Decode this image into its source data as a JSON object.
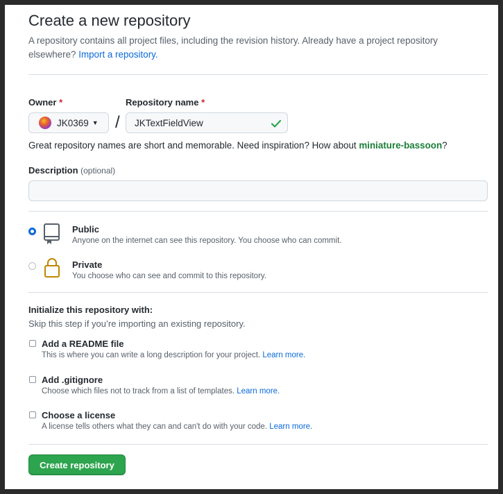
{
  "page": {
    "title": "Create a new repository",
    "intro_text": "A repository contains all project files, including the revision history. Already have a project repository elsewhere?",
    "import_link": "Import a repository."
  },
  "owner": {
    "label": "Owner",
    "required_mark": "*",
    "value": "JK0369"
  },
  "repo_name": {
    "label": "Repository name",
    "required_mark": "*",
    "value": "JKTextFieldView",
    "valid": true
  },
  "separator": "/",
  "suggestion": {
    "text": "Great repository names are short and memorable. Need inspiration? How about",
    "name": "miniature-bassoon",
    "suffix": "?"
  },
  "description": {
    "label": "Description",
    "optional": "(optional)",
    "value": ""
  },
  "visibility": {
    "selected": "public",
    "options": [
      {
        "id": "public",
        "title": "Public",
        "desc": "Anyone on the internet can see this repository. You choose who can commit.",
        "icon": "repo-icon"
      },
      {
        "id": "private",
        "title": "Private",
        "desc": "You choose who can see and commit to this repository.",
        "icon": "lock-icon"
      }
    ]
  },
  "initialize": {
    "title": "Initialize this repository with:",
    "subtitle": "Skip this step if you’re importing an existing repository.",
    "learn_more": "Learn more.",
    "options": [
      {
        "title": "Add a README file",
        "desc": "This is where you can write a long description for your project.",
        "checked": false
      },
      {
        "title": "Add .gitignore",
        "desc": "Choose which files not to track from a list of templates.",
        "checked": false
      },
      {
        "title": "Choose a license",
        "desc": "A license tells others what they can and can't do with your code.",
        "checked": false
      }
    ]
  },
  "submit": {
    "label": "Create repository"
  },
  "colors": {
    "accent": "#0969da",
    "success": "#2da44e",
    "suggestion": "#1a7f37",
    "required": "#cf222e",
    "private_icon": "#bf8700"
  }
}
